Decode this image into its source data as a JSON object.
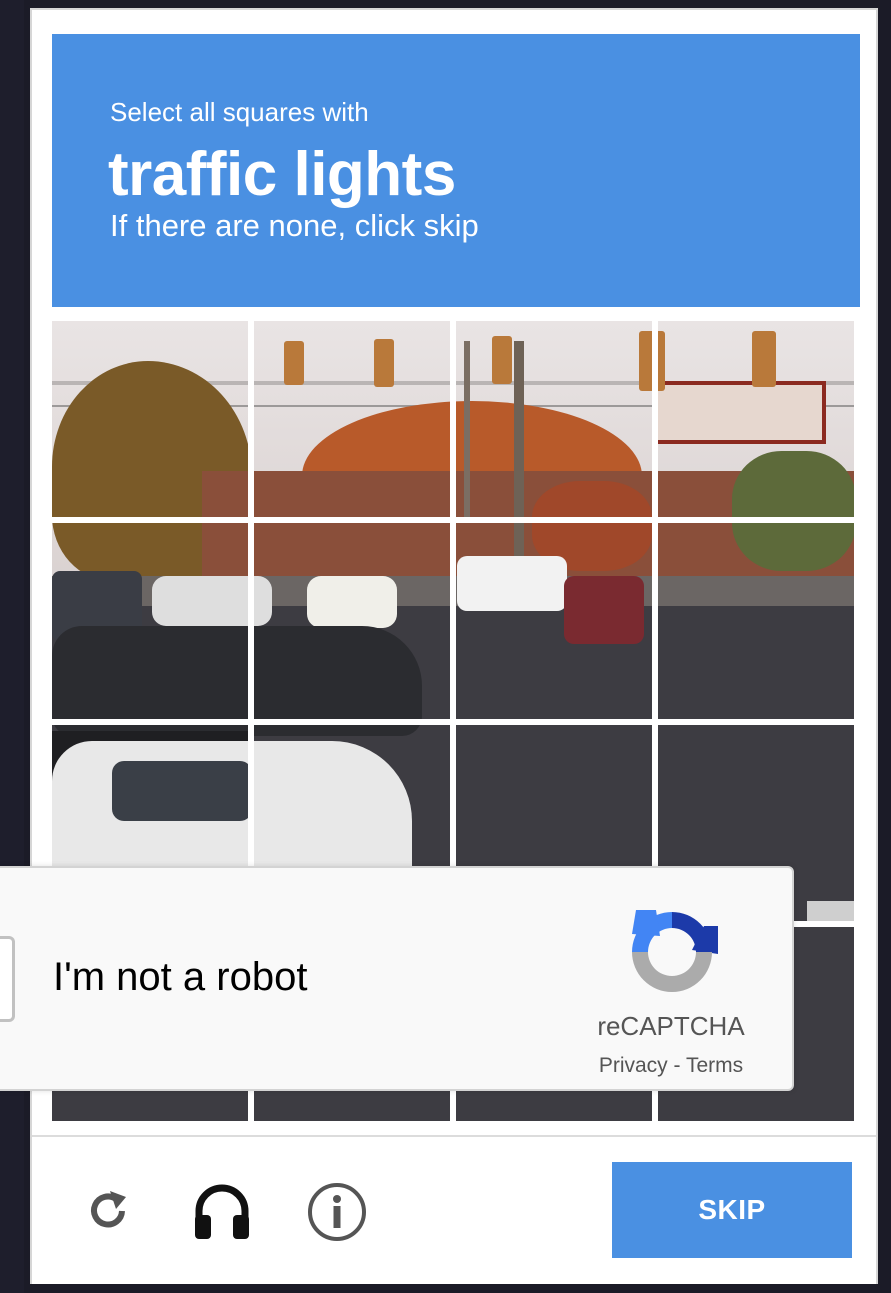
{
  "header": {
    "line1": "Select all squares with",
    "target": "traffic lights",
    "line3": "If there are none, click skip",
    "color": "#4a90e2"
  },
  "grid": {
    "rows": 4,
    "cols": 4,
    "tiles": [
      {
        "label": "tile-1-1"
      },
      {
        "label": "tile-1-2"
      },
      {
        "label": "tile-1-3"
      },
      {
        "label": "tile-1-4"
      },
      {
        "label": "tile-2-1"
      },
      {
        "label": "tile-2-2"
      },
      {
        "label": "tile-2-3"
      },
      {
        "label": "tile-2-4"
      },
      {
        "label": "tile-3-1"
      },
      {
        "label": "tile-3-2"
      },
      {
        "label": "tile-3-3"
      },
      {
        "label": "tile-3-4"
      },
      {
        "label": "tile-4-1"
      },
      {
        "label": "tile-4-2"
      },
      {
        "label": "tile-4-3"
      },
      {
        "label": "tile-4-4"
      }
    ]
  },
  "footer": {
    "reload_icon": "reload-icon",
    "audio_icon": "headphones-icon",
    "info_icon": "info-icon",
    "skip_label": "SKIP"
  },
  "checkbox": {
    "label": "I'm not a robot",
    "brand": "reCAPTCHA",
    "privacy": "Privacy",
    "separator": " - ",
    "terms": "Terms"
  }
}
